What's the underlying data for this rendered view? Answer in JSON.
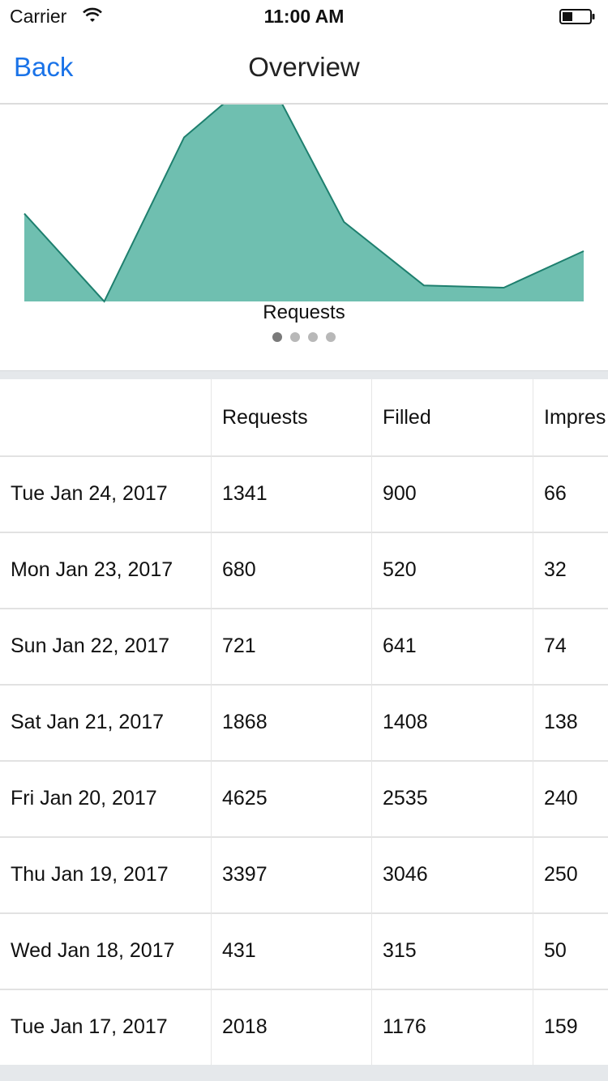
{
  "status_bar": {
    "carrier": "Carrier",
    "time": "11:00 AM"
  },
  "nav": {
    "back_label": "Back",
    "title": "Overview"
  },
  "chart_data": {
    "type": "area",
    "title": "Requests",
    "x": [
      "Tue Jan 17, 2017",
      "Wed Jan 18, 2017",
      "Thu Jan 19, 2017",
      "Fri Jan 20, 2017",
      "Sat Jan 21, 2017",
      "Sun Jan 22, 2017",
      "Mon Jan 23, 2017",
      "Tue Jan 24, 2017"
    ],
    "values": [
      2018,
      431,
      3397,
      4625,
      1868,
      721,
      680,
      1341
    ],
    "ylim": [
      431,
      3990
    ],
    "color": "#6fbfb0",
    "stroke": "#1e7f6e",
    "grid": false
  },
  "pager": {
    "count": 4,
    "active": 0
  },
  "table": {
    "headers": [
      "",
      "Requests",
      "Filled",
      "Impres"
    ],
    "rows": [
      [
        "Tue Jan 24, 2017",
        "1341",
        "900",
        "66"
      ],
      [
        "Mon Jan 23, 2017",
        "680",
        "520",
        "32"
      ],
      [
        "Sun Jan 22, 2017",
        "721",
        "641",
        "74"
      ],
      [
        "Sat Jan 21, 2017",
        "1868",
        "1408",
        "138"
      ],
      [
        "Fri Jan 20, 2017",
        "4625",
        "2535",
        "240"
      ],
      [
        "Thu Jan 19, 2017",
        "3397",
        "3046",
        "250"
      ],
      [
        "Wed Jan 18, 2017",
        "431",
        "315",
        "50"
      ],
      [
        "Tue Jan 17, 2017",
        "2018",
        "1176",
        "159"
      ]
    ]
  }
}
